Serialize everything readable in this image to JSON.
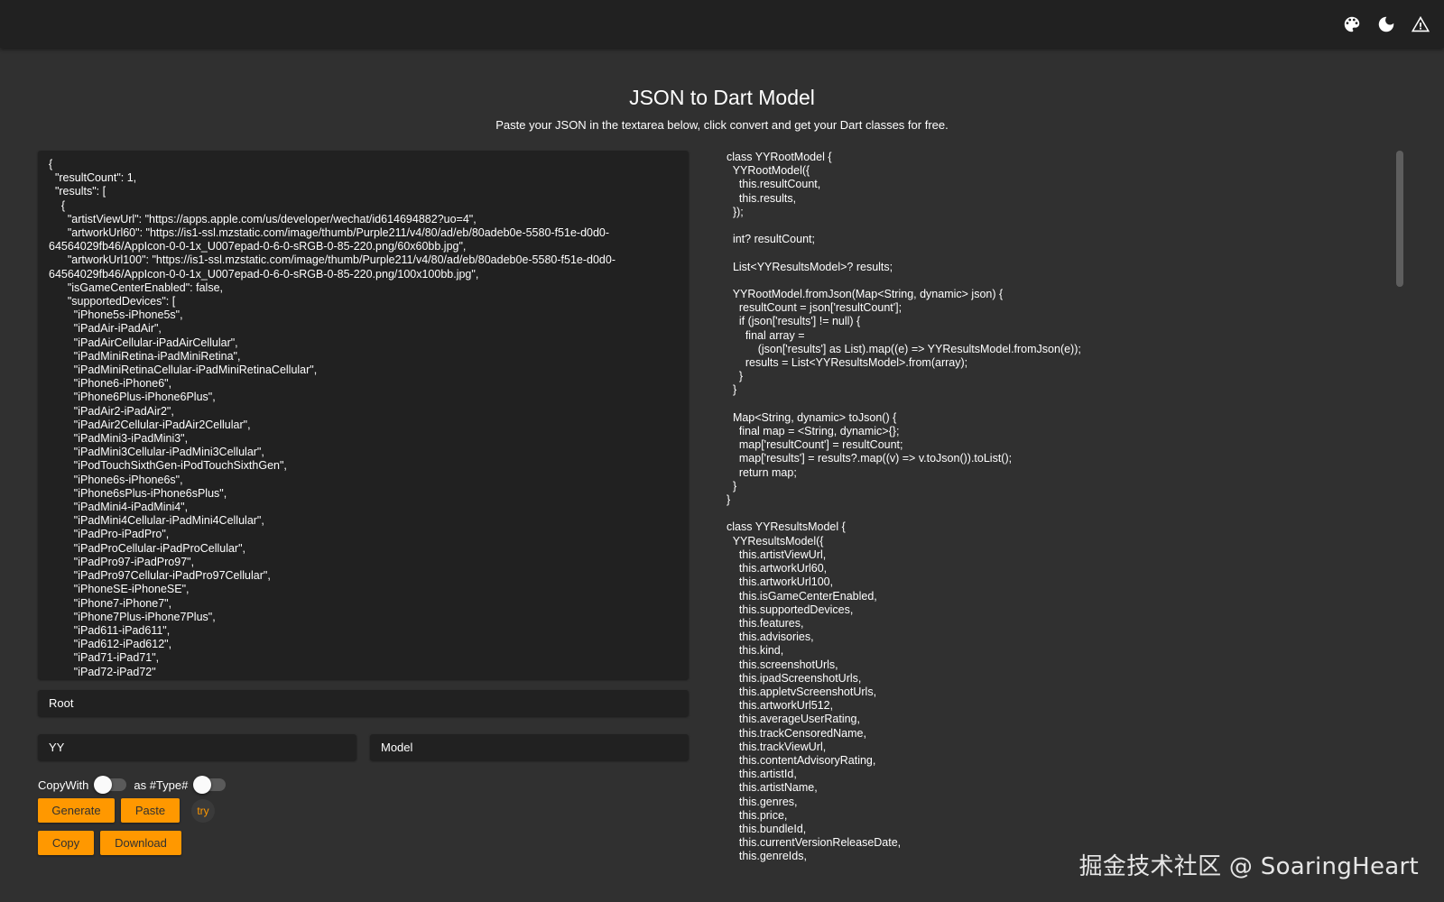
{
  "header": {
    "icons": [
      "palette-icon",
      "dark-mode-icon",
      "warning-icon"
    ]
  },
  "main": {
    "title": "JSON to Dart Model",
    "subtitle": "Paste your JSON in the textarea below, click convert and get your Dart classes for free."
  },
  "editor": {
    "json_text": "{\n  \"resultCount\": 1,\n  \"results\": [\n    {\n      \"artistViewUrl\": \"https://apps.apple.com/us/developer/wechat/id614694882?uo=4\",\n      \"artworkUrl60\": \"https://is1-ssl.mzstatic.com/image/thumb/Purple211/v4/80/ad/eb/80adeb0e-5580-f51e-d0d0-64564029fb46/AppIcon-0-0-1x_U007epad-0-6-0-sRGB-0-85-220.png/60x60bb.jpg\",\n      \"artworkUrl100\": \"https://is1-ssl.mzstatic.com/image/thumb/Purple211/v4/80/ad/eb/80adeb0e-5580-f51e-d0d0-64564029fb46/AppIcon-0-0-1x_U007epad-0-6-0-sRGB-0-85-220.png/100x100bb.jpg\",\n      \"isGameCenterEnabled\": false,\n      \"supportedDevices\": [\n        \"iPhone5s-iPhone5s\",\n        \"iPadAir-iPadAir\",\n        \"iPadAirCellular-iPadAirCellular\",\n        \"iPadMiniRetina-iPadMiniRetina\",\n        \"iPadMiniRetinaCellular-iPadMiniRetinaCellular\",\n        \"iPhone6-iPhone6\",\n        \"iPhone6Plus-iPhone6Plus\",\n        \"iPadAir2-iPadAir2\",\n        \"iPadAir2Cellular-iPadAir2Cellular\",\n        \"iPadMini3-iPadMini3\",\n        \"iPadMini3Cellular-iPadMini3Cellular\",\n        \"iPodTouchSixthGen-iPodTouchSixthGen\",\n        \"iPhone6s-iPhone6s\",\n        \"iPhone6sPlus-iPhone6sPlus\",\n        \"iPadMini4-iPadMini4\",\n        \"iPadMini4Cellular-iPadMini4Cellular\",\n        \"iPadPro-iPadPro\",\n        \"iPadProCellular-iPadProCellular\",\n        \"iPadPro97-iPadPro97\",\n        \"iPadPro97Cellular-iPadPro97Cellular\",\n        \"iPhoneSE-iPhoneSE\",\n        \"iPhone7-iPhone7\",\n        \"iPhone7Plus-iPhone7Plus\",\n        \"iPad611-iPad611\",\n        \"iPad612-iPad612\",\n        \"iPad71-iPad71\",\n        \"iPad72-iPad72\""
  },
  "form": {
    "root_name": "Root",
    "prefix": "YY",
    "suffix": "Model",
    "copywith_label": "CopyWith",
    "type_label": "as #Type#"
  },
  "buttons": {
    "generate": "Generate",
    "paste": "Paste",
    "try": "try",
    "copy": "Copy",
    "download": "Download"
  },
  "output": {
    "dart_code": "class YYRootModel {\n  YYRootModel({\n    this.resultCount,\n    this.results,\n  });\n\n  int? resultCount;\n\n  List<YYResultsModel>? results;\n\n  YYRootModel.fromJson(Map<String, dynamic> json) {\n    resultCount = json['resultCount'];\n    if (json['results'] != null) {\n      final array =\n          (json['results'] as List).map((e) => YYResultsModel.fromJson(e));\n      results = List<YYResultsModel>.from(array);\n    }\n  }\n\n  Map<String, dynamic> toJson() {\n    final map = <String, dynamic>{};\n    map['resultCount'] = resultCount;\n    map['results'] = results?.map((v) => v.toJson()).toList();\n    return map;\n  }\n}\n\nclass YYResultsModel {\n  YYResultsModel({\n    this.artistViewUrl,\n    this.artworkUrl60,\n    this.artworkUrl100,\n    this.isGameCenterEnabled,\n    this.supportedDevices,\n    this.features,\n    this.advisories,\n    this.kind,\n    this.screenshotUrls,\n    this.ipadScreenshotUrls,\n    this.appletvScreenshotUrls,\n    this.artworkUrl512,\n    this.averageUserRating,\n    this.trackCensoredName,\n    this.trackViewUrl,\n    this.contentAdvisoryRating,\n    this.artistId,\n    this.artistName,\n    this.genres,\n    this.price,\n    this.bundleId,\n    this.currentVersionReleaseDate,\n    this.genreIds,"
  },
  "watermark": "掘金技术社区 @ SoaringHeart",
  "colors": {
    "background": "#303030",
    "topbar": "#212121",
    "panel": "#212121",
    "accent": "#ff9800"
  }
}
